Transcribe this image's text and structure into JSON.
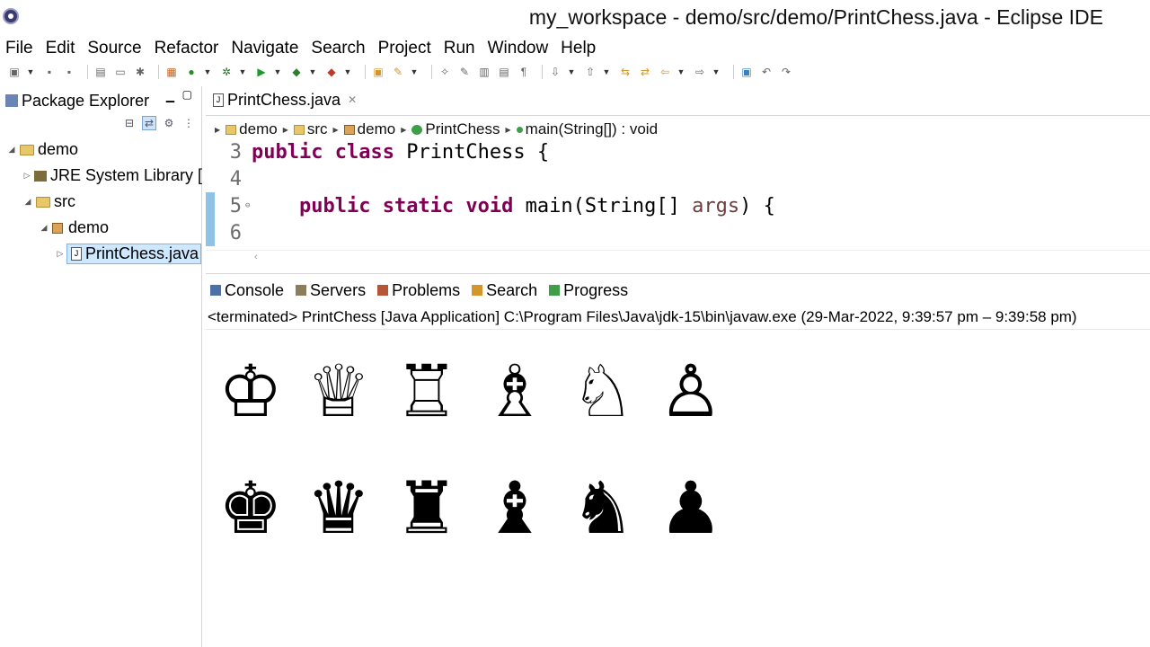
{
  "window": {
    "title": "my_workspace - demo/src/demo/PrintChess.java - Eclipse IDE"
  },
  "menu": [
    {
      "label": "File"
    },
    {
      "label": "Edit"
    },
    {
      "label": "Source"
    },
    {
      "label": "Refactor"
    },
    {
      "label": "Navigate"
    },
    {
      "label": "Search"
    },
    {
      "label": "Project"
    },
    {
      "label": "Run"
    },
    {
      "label": "Window"
    },
    {
      "label": "Help"
    }
  ],
  "package_explorer": {
    "title": "Package Explorer",
    "tree": [
      {
        "label": "demo"
      },
      {
        "label": "JRE System Library ["
      },
      {
        "label": "src"
      },
      {
        "label": "demo"
      },
      {
        "label": "PrintChess.java"
      }
    ]
  },
  "editor": {
    "tab_label": "PrintChess.java",
    "breadcrumb": [
      "demo",
      "src",
      "demo",
      "PrintChess",
      "main(String[]) : void"
    ],
    "lines": [
      {
        "no": "3",
        "kw": "public class",
        "rest": " PrintChess {"
      },
      {
        "no": "4",
        "kw": "",
        "rest": ""
      },
      {
        "no": "5",
        "kw": "public static void",
        "rest": " main(String[] ",
        "param": "args",
        "tail": ") {"
      },
      {
        "no": "6",
        "kw": "",
        "rest": ""
      }
    ]
  },
  "console": {
    "tabs": [
      "Console",
      "Servers",
      "Problems",
      "Search",
      "Progress"
    ],
    "header": "<terminated> PrintChess [Java Application] C:\\Program Files\\Java\\jdk-15\\bin\\javaw.exe  (29-Mar-2022, 9:39:57 pm – 9:39:58 pm)",
    "output_rows": [
      [
        "♔",
        "♕",
        "♖",
        "♗",
        "♘",
        "♙"
      ],
      [
        "♚",
        "♛",
        "♜",
        "♝",
        "♞",
        "♟"
      ]
    ]
  },
  "icons": {
    "toolbar": [
      "new-icon",
      "save-icon",
      "save-all-icon",
      "print-icon",
      "terminal-icon",
      "debug-icon",
      "run-icon",
      "coverage-icon",
      "external-tools-icon",
      "new-java-project-icon",
      "new-package-icon",
      "new-class-icon",
      "open-type-icon",
      "search-icon",
      "back-icon",
      "forward-icon"
    ]
  }
}
